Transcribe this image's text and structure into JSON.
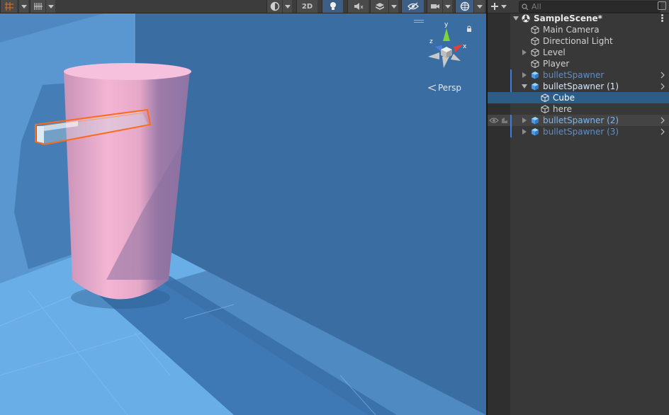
{
  "scene_view": {
    "toolbar": {
      "toggle_2d_label": "2D"
    },
    "projection_label": "Persp",
    "gizmo_axes": {
      "y": "y",
      "x": "x",
      "z": "z"
    }
  },
  "hierarchy": {
    "search_placeholder": "All",
    "scene_name": "SampleScene*",
    "items": [
      {
        "label": "Main Camera",
        "type": "gameobject"
      },
      {
        "label": "Directional Light",
        "type": "gameobject"
      },
      {
        "label": "Level",
        "type": "gameobject"
      },
      {
        "label": "Player",
        "type": "gameobject"
      },
      {
        "label": "bulletSpawner",
        "type": "prefab"
      },
      {
        "label": "bulletSpawner (1)",
        "type": "prefab"
      },
      {
        "label": "Cube",
        "type": "gameobject"
      },
      {
        "label": "here",
        "type": "gameobject"
      },
      {
        "label": "bulletSpawner (2)",
        "type": "prefab"
      },
      {
        "label": "bulletSpawner (3)",
        "type": "prefab"
      }
    ]
  },
  "colors": {
    "selection": "#2c5d87",
    "prefab_text": "#7eb6ec",
    "cylinder": "#f4b6d2",
    "sky_wall": "#3a6ea2",
    "floor": "#6aaee8",
    "selection_outline": "#ff6a1a"
  },
  "icons": [
    "grid-icon",
    "snap-icon",
    "shading-mode-icon",
    "light-icon",
    "audio-icon",
    "effects-icon",
    "visibility-icon",
    "camera-icon",
    "gizmos-icon",
    "plus-icon",
    "search-icon",
    "lock-icon",
    "scene-icon",
    "gameobject-icon",
    "prefab-icon",
    "eye-icon",
    "pick-icon"
  ]
}
